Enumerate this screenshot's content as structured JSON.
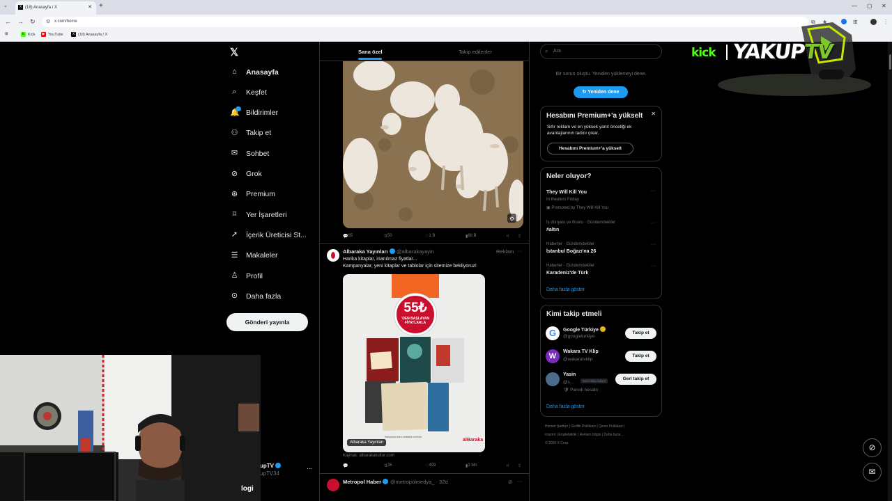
{
  "browser": {
    "tab_title": "(18) Anasayfa / X",
    "url": "x.com/home",
    "bookmarks": [
      "Kick",
      "YouTube",
      "(18) Anasayfa / X"
    ]
  },
  "nav": {
    "items": [
      {
        "label": "Anasayfa",
        "icon": "home-icon"
      },
      {
        "label": "Keşfet",
        "icon": "search-icon"
      },
      {
        "label": "Bildirimler",
        "icon": "bell-icon"
      },
      {
        "label": "Takip et",
        "icon": "person-plus-icon"
      },
      {
        "label": "Sohbet",
        "icon": "envelope-icon"
      },
      {
        "label": "Grok",
        "icon": "grok-icon"
      },
      {
        "label": "Premium",
        "icon": "x-premium-icon"
      },
      {
        "label": "Yer İşaretleri",
        "icon": "bookmark-icon"
      },
      {
        "label": "İçerik Üreticisi St...",
        "icon": "rocket-icon"
      },
      {
        "label": "Makaleler",
        "icon": "article-icon"
      },
      {
        "label": "Profil",
        "icon": "person-icon"
      },
      {
        "label": "Daha fazla",
        "icon": "more-circle-icon"
      }
    ],
    "post_button": "Gönderi yayınla",
    "account": {
      "name": "upTV",
      "handle": "upTV34"
    }
  },
  "timeline": {
    "tabs": [
      "Sana özel",
      "Takip edilenler"
    ],
    "tweet1_actions": {
      "replies": "85",
      "retweets": "50",
      "likes": "1 B",
      "views": "68 B"
    },
    "tweet2": {
      "name": "Albaraka Yayınları",
      "handle": "@albarakayayin",
      "ad_label": "Reklam",
      "text1": "Harika kitaplar, inanılmaz fiyatlar...",
      "text2": "Kampanyalar, yeni kitaplar ve tablolar için sitemize bekliyoruz!",
      "price": "55₺",
      "price_sub": "'DEN BAŞLAYAN FİYATLARLA",
      "tag": "Albaraka Yayınları",
      "brand": "alBaraka",
      "promo_small": "Kampanya sonu stoklarla sınırlıdır.",
      "source": "Kaynak: albarakakultur.com",
      "retweets": "35",
      "likes": "499",
      "views": "3 Mn"
    },
    "tweet3": {
      "name": "Metropol Haber",
      "handle": "@metropolmedya_ · 32d"
    }
  },
  "sidebar": {
    "search_placeholder": "Ara",
    "error_message": "Bir sorun oluştu. Yeniden yüklemeyi dene.",
    "retry": "Yeniden dene",
    "premium": {
      "title": "Hesabını Premium+'a yükselt",
      "desc": "Sıfır reklam ve en yüksek yanıt önceliği ek avantajlarının tadını çıkar.",
      "button": "Hesabını Premium+'a yükselt"
    },
    "trends": {
      "title": "Neler oluyor?",
      "items": [
        {
          "title": "They Will Kill You",
          "context": "In theaters Friday",
          "extra": "Promoted by They Will Kill You"
        },
        {
          "context": "İş dünyası ve finans · Gündemdekiler",
          "title": "#altın"
        },
        {
          "context": "Haberler · Gündemdekiler",
          "title": "İstanbul Boğazı'na 26"
        },
        {
          "context": "Haberler · Gündemdekiler",
          "title": "Karadeniz'de Türk"
        }
      ],
      "show_more": "Daha fazla göster"
    },
    "who_to_follow": {
      "title": "Kimi takip etmeli",
      "items": [
        {
          "name": "Google Türkiye",
          "handle": "@googleturkiye",
          "button": "Takip et"
        },
        {
          "name": "Wakara TV Klip",
          "handle": "@wakaratvklip",
          "button": "Takip et"
        },
        {
          "name": "Yasin",
          "handle": "@s...",
          "badge": "Seni takip ediyor",
          "note": "Parodi hesabı",
          "button": "Geri takip et"
        }
      ],
      "show_more": "Daha fazla göster"
    },
    "footer": [
      "Hizmet Şartları",
      "Gizlilik Politikası",
      "Çerez Politikası",
      "Imprint",
      "Erişilebilirlik",
      "Reklam bilgisi",
      "Daha fazla ...",
      "© 2026 X Corp."
    ]
  },
  "overlay": {
    "kick": "kick",
    "brand_a": "YAKUP",
    "brand_b": "TV",
    "logi": "logi"
  }
}
